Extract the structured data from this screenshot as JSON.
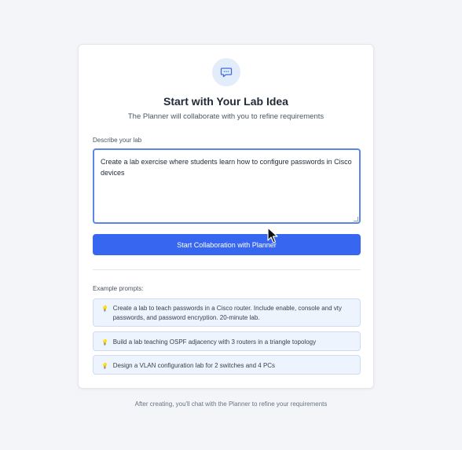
{
  "card": {
    "icon": "chat-bubble-icon",
    "title": "Start with Your Lab Idea",
    "subtitle": "The Planner will collaborate with you to refine requirements",
    "field_label": "Describe your lab",
    "textarea_value": "Create a lab exercise where students learn how to configure passwords in Cisco devices",
    "start_button": "Start Collaboration with Planner",
    "examples_label": "Example prompts:",
    "examples": [
      {
        "icon": "lightbulb-icon",
        "text": "Create a lab to teach passwords in a Cisco router. Include enable, console and vty passwords, and password encryption. 20-minute lab."
      },
      {
        "icon": "lightbulb-icon",
        "text": "Build a lab teaching OSPF adjacency with 3 routers in a triangle topology"
      },
      {
        "icon": "lightbulb-icon",
        "text": "Design a VLAN configuration lab for 2 switches and 4 PCs"
      }
    ]
  },
  "footer_note": "After creating, you'll chat with the Planner to refine your requirements",
  "colors": {
    "accent": "#3767f0",
    "icon_bg": "#e3ecfb",
    "example_bg": "#eef4fd",
    "page_bg": "#f3f5f9"
  }
}
